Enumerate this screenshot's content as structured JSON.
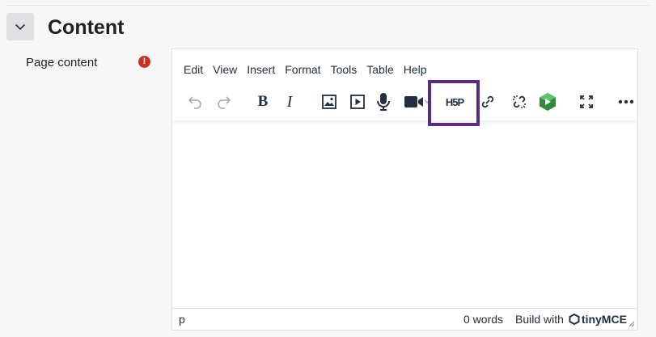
{
  "section": {
    "title": "Content",
    "toggle_icon": "chevron-down-icon"
  },
  "field": {
    "label": "Page content",
    "required_icon": "!",
    "required_color": "#ca3120"
  },
  "menu": [
    "Edit",
    "View",
    "Insert",
    "Format",
    "Tools",
    "Table",
    "Help"
  ],
  "toolbar": {
    "bold_label": "B",
    "italic_label": "I",
    "h5p_label": "H5P",
    "buttons": [
      "undo-icon",
      "redo-icon",
      "bold-icon",
      "italic-icon",
      "image-icon",
      "media-icon",
      "record-audio-icon",
      "record-video-icon",
      "h5p-icon",
      "link-icon",
      "unlink-icon",
      "recording-plugin-icon",
      "fullscreen-icon",
      "more-icon"
    ]
  },
  "statusbar": {
    "path": "p",
    "word_count": "0 words",
    "build_with": "Build with",
    "brand": "tinyMCE"
  },
  "colors": {
    "highlight": "#5b2b82",
    "accent_green": "#2e8b3a"
  }
}
